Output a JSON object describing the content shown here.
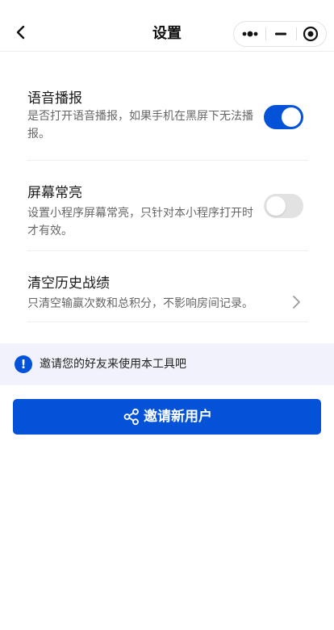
{
  "navbar": {
    "title": "设置",
    "back_icon": "chevron-left-icon",
    "capsule": {
      "more_icon": "more-dots-icon",
      "minimize_icon": "minus-icon",
      "close_icon": "target-circle-icon"
    }
  },
  "settings": [
    {
      "title": "语音播报",
      "description": "是否打开语音播报，如果手机在黑屏下无法播报。",
      "control": "toggle",
      "enabled": true
    },
    {
      "title": "屏幕常亮",
      "description": "设置小程序屏幕常亮，只针对本小程序打开时才有效。",
      "control": "toggle",
      "enabled": false
    },
    {
      "title": "清空历史战绩",
      "description": "只清空输赢次数和总积分，不影响房间记录。",
      "control": "chevron"
    }
  ],
  "invite_banner": {
    "icon": "info-icon",
    "icon_glyph": "!",
    "text": "邀请您的好友来使用本工具吧"
  },
  "invite_button": {
    "icon": "share-icon",
    "label": "邀请新用户"
  },
  "colors": {
    "accent": "#0452d8",
    "toggle_off": "#e2e2e2",
    "banner_bg": "#f1f2fb",
    "secondary_text": "#666666"
  }
}
